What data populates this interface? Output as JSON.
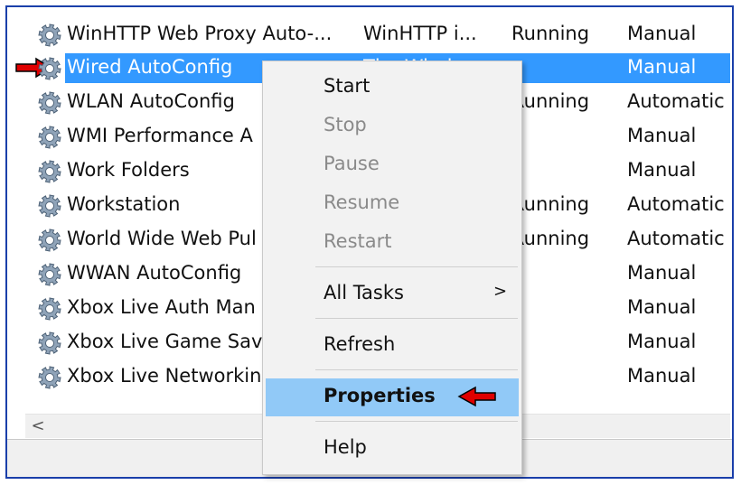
{
  "colors": {
    "frame_border": "#1a3faa",
    "selection": "#3399ff",
    "menu_hover": "#91c9f7",
    "callout_arrow": "#e00000"
  },
  "services": [
    {
      "name": "WinHTTP Web Proxy Auto-...",
      "description": "WinHTTP i...",
      "status": "Running",
      "startup": "Manual"
    },
    {
      "name": "Wired AutoConfig",
      "description": "The Windo...",
      "status": "",
      "startup": "Manual",
      "selected": true
    },
    {
      "name": "WLAN AutoConfig",
      "description": "",
      "status": "Running",
      "startup": "Automatic"
    },
    {
      "name": "WMI Performance A",
      "description": "",
      "status": "",
      "startup": "Manual"
    },
    {
      "name": "Work Folders",
      "description": "",
      "status": "",
      "startup": "Manual"
    },
    {
      "name": "Workstation",
      "description": "",
      "status": "Running",
      "startup": "Automatic"
    },
    {
      "name": "World Wide Web Pul",
      "description": "",
      "status": "Running",
      "startup": "Automatic"
    },
    {
      "name": "WWAN AutoConfig",
      "description": "",
      "status": "",
      "startup": "Manual"
    },
    {
      "name": "Xbox Live Auth Man",
      "description": "",
      "status": "",
      "startup": "Manual"
    },
    {
      "name": "Xbox Live Game Save",
      "description": "",
      "status": "",
      "startup": "Manual"
    },
    {
      "name": "Xbox Live Networkin",
      "description": "",
      "status": "",
      "startup": "Manual"
    }
  ],
  "icons": {
    "service": "gear-icon",
    "callout": "red-arrow-icon",
    "scroll_left": "chevron-left-icon",
    "submenu": "chevron-right-icon"
  },
  "scroll_left_glyph": "<",
  "context_menu": {
    "start": "Start",
    "stop": "Stop",
    "pause": "Pause",
    "resume": "Resume",
    "restart": "Restart",
    "all_tasks": "All Tasks",
    "all_tasks_arrow": ">",
    "refresh": "Refresh",
    "properties": "Properties",
    "help": "Help"
  }
}
